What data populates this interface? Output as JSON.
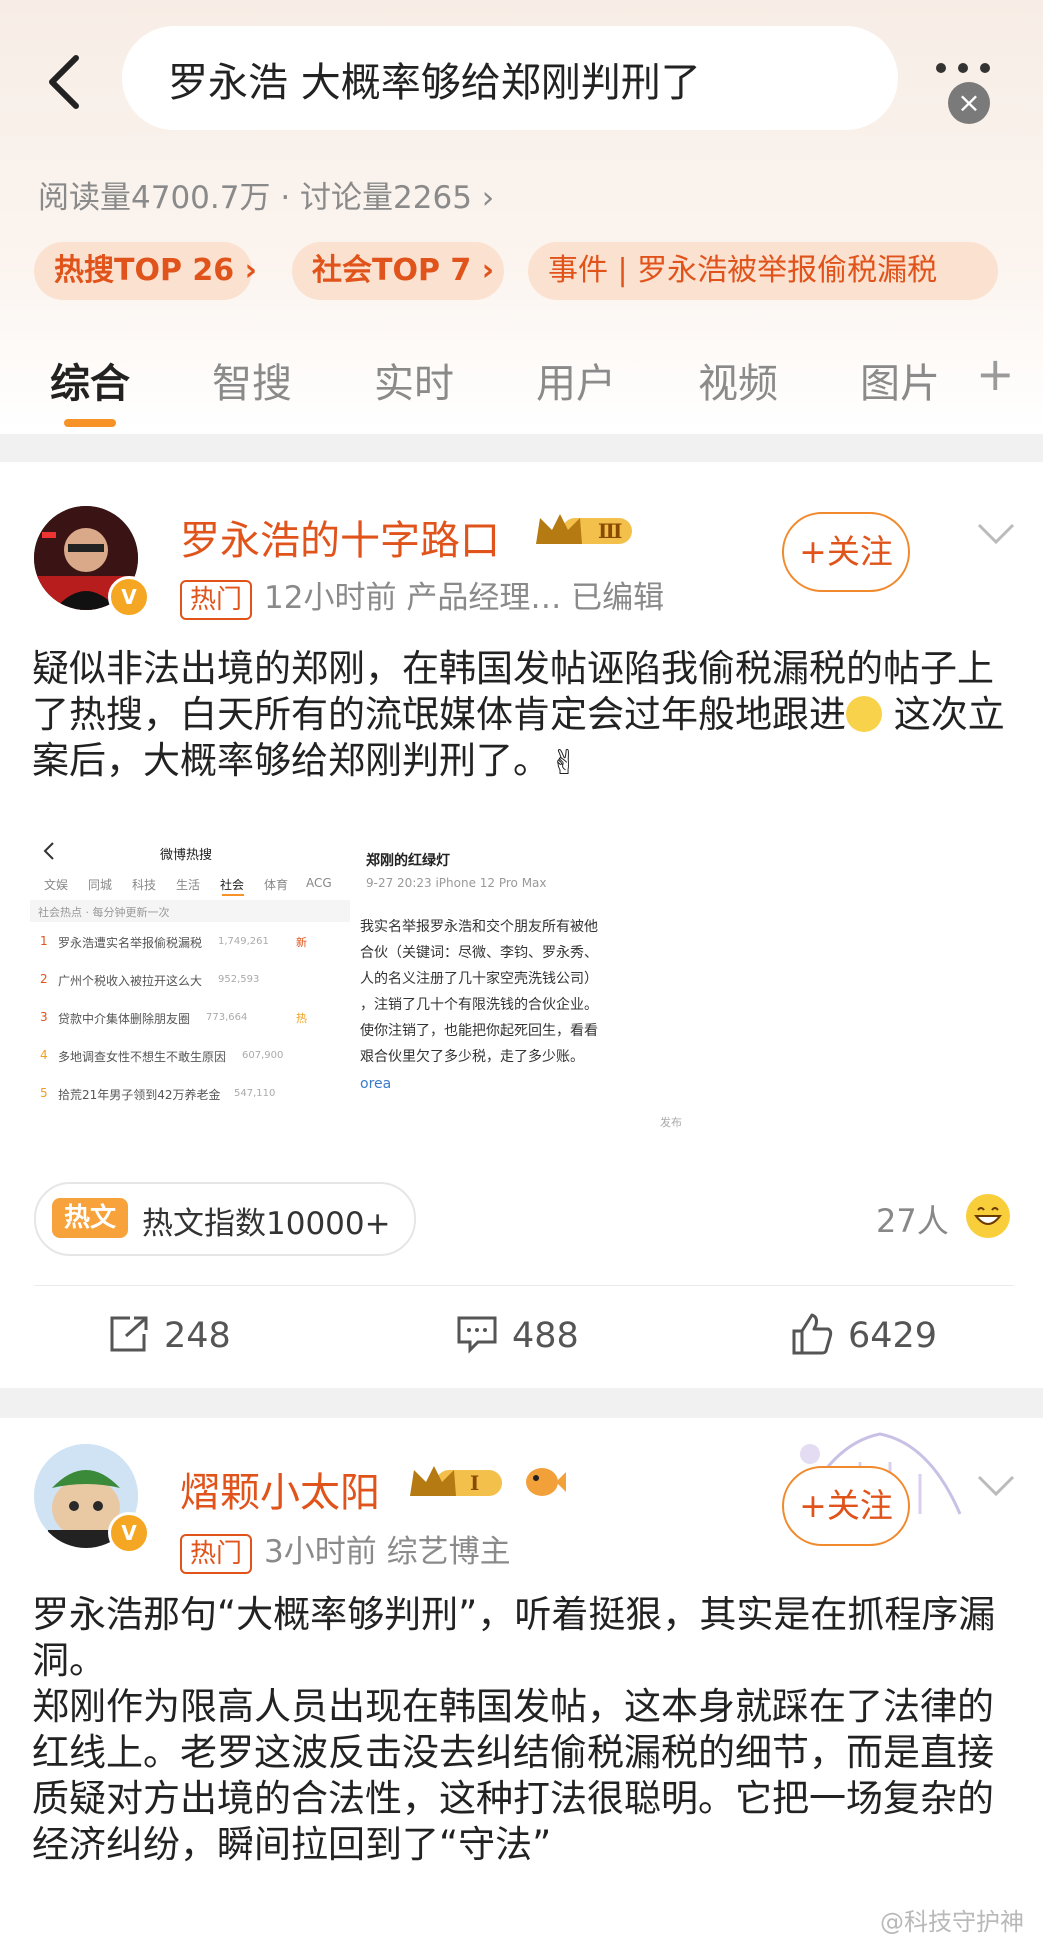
{
  "search": {
    "query": "罗永浩 大概率够给郑刚判刑了",
    "stats": "阅读量4700.7万 · 讨论量2265 ›"
  },
  "tags": [
    {
      "label": "热搜TOP 26 ›"
    },
    {
      "label": "社会TOP 7 ›"
    },
    {
      "label": "事件 | 罗永浩被举报偷税漏税"
    }
  ],
  "tabs": [
    {
      "label": "综合"
    },
    {
      "label": "智搜"
    },
    {
      "label": "实时"
    },
    {
      "label": "用户"
    },
    {
      "label": "视频"
    },
    {
      "label": "图片"
    }
  ],
  "tab_plus": "+",
  "posts": [
    {
      "user": "罗永浩的十字路口",
      "level": "Ⅲ",
      "hot_badge": "热门",
      "meta": "12小时前  产品经理…  已编辑",
      "follow": "+关注",
      "avatar_caption": "罗永浩的十字路口",
      "text_part1": "疑似非法出境的郑刚，在韩国发帖诬陷我偷税漏税的帖子上了热搜，白天所有的流氓媒体肯定会过年般地跟进",
      "text_part2": " 这次立案后，大概率够给郑刚判刑了。",
      "screenshot": {
        "title": "微博热搜",
        "nav": [
          "文娱",
          "同城",
          "科技",
          "生活",
          "社会",
          "体育",
          "ACG"
        ],
        "subhead": "社会热点 · 每分钟更新一次",
        "items": [
          {
            "rank": "1",
            "text": "罗永浩遭实名举报偷税漏税",
            "count": "1,749,261",
            "badge": "新"
          },
          {
            "rank": "2",
            "text": "广州个税收入被拉开这么大",
            "count": "952,593",
            "badge": ""
          },
          {
            "rank": "3",
            "text": "贷款中介集体删除朋友圈",
            "count": "773,664",
            "badge": "热"
          },
          {
            "rank": "4",
            "text": "多地调查女性不想生不敢生原因",
            "count": "607,900",
            "badge": ""
          },
          {
            "rank": "5",
            "text": "拾荒21年男子领到42万养老金",
            "count": "547,110",
            "badge": ""
          }
        ],
        "post_author": "郑刚的红绿灯",
        "post_meta": "9-27 20:23  iPhone 12 Pro Max",
        "post_lines": [
          "我实名举报罗永浩和交个朋友所有被他",
          "合伙（关键词：尽微、李钧、罗永秀、",
          "人的名义注册了几十家空壳洗钱公司）",
          "，注销了几十个有限洗钱的合伙企业。",
          "使你注销了，也能把你起死回生，看看",
          "艰合伙里欠了多少税，走了多少账。"
        ],
        "post_link": "orea",
        "post_side": "发布"
      },
      "hot_doc_label": "热文",
      "hot_doc_text": "热文指数10000+",
      "people": "27人",
      "reposts": "248",
      "comments": "488",
      "likes": "6429"
    },
    {
      "user": "熠颗小太阳",
      "level": "Ⅰ",
      "hot_badge": "热门",
      "meta": "3小时前  综艺博主",
      "follow": "+关注",
      "text": "罗永浩那句“大概率够判刑”，听着挺狠，其实是在抓程序漏洞。\n郑刚作为限高人员出现在韩国发帖，这本身就踩在了法律的红线上。老罗这波反击没去纠结偷税漏税的细节，而是直接质疑对方出境的合法性，这种打法很聪明。它把一场复杂的经济纠纷，瞬间拉回到了“守法”"
    }
  ],
  "watermark": "@科技守护神",
  "colors": {
    "accent": "#e0541c",
    "tab_indicator": "#f79226",
    "tag_bg": "#fbe1cf"
  }
}
